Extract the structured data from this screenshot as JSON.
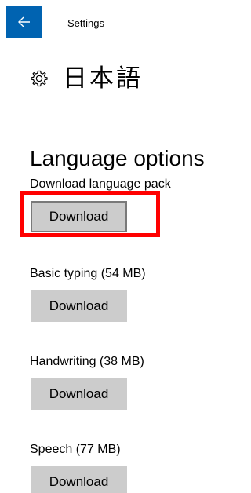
{
  "header": {
    "back_icon": "back-arrow-icon",
    "title": "Settings",
    "accent_color": "#0063b1"
  },
  "page": {
    "icon": "gear-icon",
    "title": "日本語"
  },
  "section": {
    "title": "Language options"
  },
  "options": [
    {
      "label": "Download language pack",
      "button_label": "Download",
      "focused": true
    },
    {
      "label": "Basic typing (54 MB)",
      "button_label": "Download",
      "focused": false
    },
    {
      "label": "Handwriting (38 MB)",
      "button_label": "Download",
      "focused": false
    },
    {
      "label": "Speech (77 MB)",
      "button_label": "Download",
      "focused": false
    }
  ],
  "highlight_color": "#ff0000"
}
